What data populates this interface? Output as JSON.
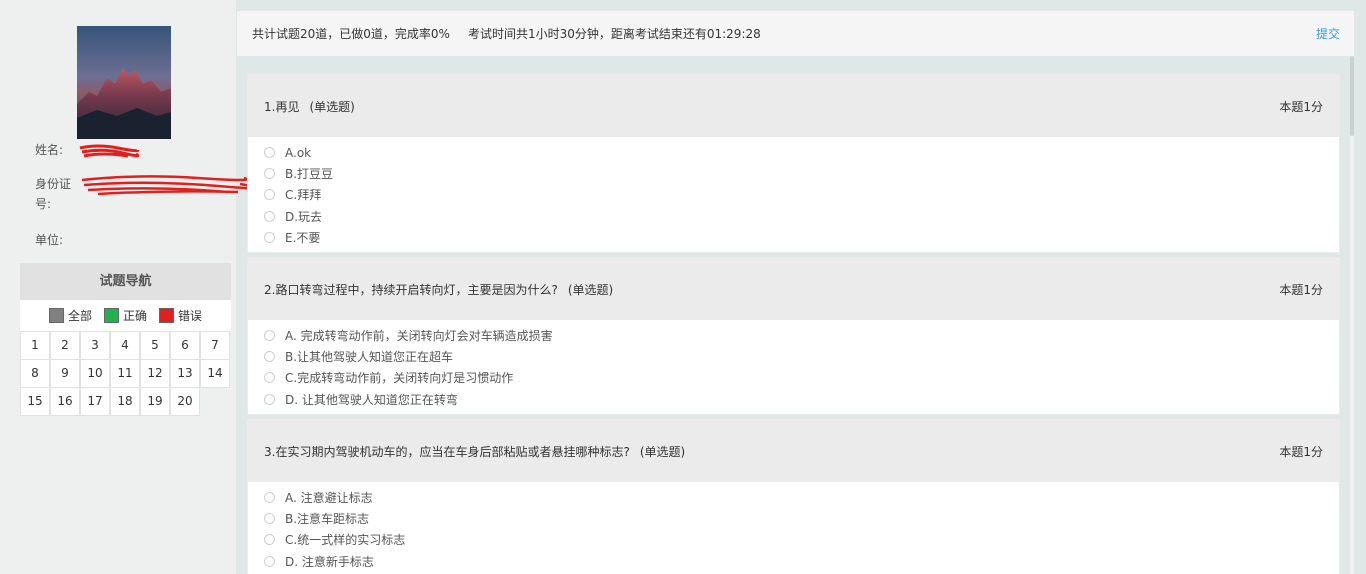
{
  "profile": {
    "name_label": "姓名:",
    "id_label": "身份证号:",
    "unit_label": "单位:"
  },
  "nav": {
    "title": "试题导航",
    "legend": [
      {
        "label": "全部",
        "color": "#808080"
      },
      {
        "label": "正确",
        "color": "#22b24c"
      },
      {
        "label": "错误",
        "color": "#e02020"
      }
    ],
    "numbers": [
      "1",
      "2",
      "3",
      "4",
      "5",
      "6",
      "7",
      "8",
      "9",
      "10",
      "11",
      "12",
      "13",
      "14",
      "15",
      "16",
      "17",
      "18",
      "19",
      "20"
    ]
  },
  "topbar": {
    "progress": "共计试题20道，已做0道，完成率0%",
    "timer": "考试时间共1小时30分钟，距离考试结束还有01:29:28",
    "submit_label": "提交"
  },
  "questions": [
    {
      "title": "1.再见",
      "type": "(单选题)",
      "score": "本题1分",
      "options": [
        "A.ok",
        "B.打豆豆",
        "C.拜拜",
        "D.玩去",
        "E.不要"
      ]
    },
    {
      "title": "2.路口转弯过程中，持续开启转向灯，主要是因为什么?",
      "type": "(单选题)",
      "score": "本题1分",
      "options": [
        "A. 完成转弯动作前，关闭转向灯会对车辆造成损害",
        "B.让其他驾驶人知道您正在超车",
        "C.完成转弯动作前，关闭转向灯是习惯动作",
        "D. 让其他驾驶人知道您正在转弯"
      ]
    },
    {
      "title": "3.在实习期内驾驶机动车的，应当在车身后部粘贴或者悬挂哪种标志?",
      "type": "(单选题)",
      "score": "本题1分",
      "options": [
        "A. 注意避让标志",
        "B.注意车距标志",
        "C.统一式样的实习标志",
        "D. 注意新手标志"
      ]
    }
  ]
}
